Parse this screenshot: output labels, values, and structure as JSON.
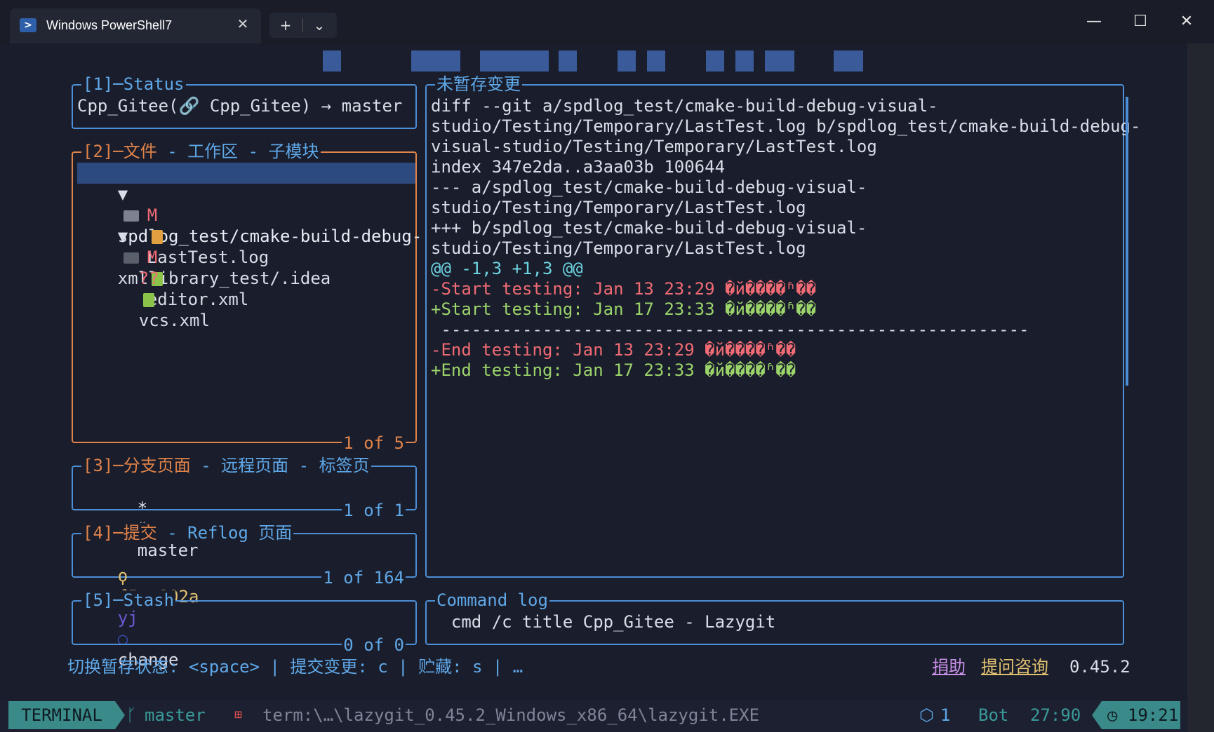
{
  "window": {
    "tab_title": "Windows PowerShell7",
    "tab_close": "✕",
    "new_tab": "+",
    "dropdown": "⌄",
    "minimize": "—",
    "maximize": "☐",
    "close": "✕",
    "tab_icon": ">"
  },
  "status_panel": {
    "title": "[1]─Status",
    "line": "Cpp_Gitee(🔗 Cpp_Gitee) → master"
  },
  "files_panel": {
    "title_active": "[2]─文件",
    "title_rest": " - 工作区 - 子模块",
    "footer": "1 of 5",
    "rows": [
      {
        "arrow": "▼",
        "status": "",
        "name": "spdlog_test/cmake-build-debug-"
      },
      {
        "arrow": "",
        "status": "M",
        "name": "LastTest.log"
      },
      {
        "arrow": "▼",
        "status": "",
        "name": "xmllibrary_test/.idea"
      },
      {
        "arrow": "",
        "status": "M",
        "name": "editor.xml"
      },
      {
        "arrow": "",
        "status": "??",
        "name": "vcs.xml"
      }
    ]
  },
  "branches_panel": {
    "title_active": "[3]─分支页面",
    "title_rest": " - 远程页面 - 标签页",
    "footer": "1 of 1",
    "line_star": "*",
    "line_branch": "master"
  },
  "commits_panel": {
    "title_active": "[4]─提交",
    "title_rest": " - Reflog 页面",
    "footer": "1 of 164",
    "hash": "f5aa802a",
    "author": "yj",
    "message": "change"
  },
  "stash_panel": {
    "title": "[5]─Stash",
    "footer": "0 of 0"
  },
  "diff_panel": {
    "title": "未暂存变更",
    "lines": [
      {
        "type": "normal",
        "text": "diff --git a/spdlog_test/cmake-build-debug-visual-"
      },
      {
        "type": "normal",
        "text": "studio/Testing/Temporary/LastTest.log b/spdlog_test/cmake-build-debug-"
      },
      {
        "type": "normal",
        "text": "visual-studio/Testing/Temporary/LastTest.log"
      },
      {
        "type": "normal",
        "text": "index 347e2da..a3aa03b 100644"
      },
      {
        "type": "normal",
        "text": "--- a/spdlog_test/cmake-build-debug-visual-"
      },
      {
        "type": "normal",
        "text": "studio/Testing/Temporary/LastTest.log"
      },
      {
        "type": "normal",
        "text": "+++ b/spdlog_test/cmake-build-debug-visual-"
      },
      {
        "type": "normal",
        "text": "studio/Testing/Temporary/LastTest.log"
      },
      {
        "type": "hunk",
        "text": "@@ -1,3 +1,3 @@"
      },
      {
        "type": "del",
        "text": "-Start testing: Jan 13 23:29 �й����ʱ��"
      },
      {
        "type": "add",
        "text": "+Start testing: Jan 17 23:33 �й����ʱ��"
      },
      {
        "type": "normal",
        "text": " ----------------------------------------------------------"
      },
      {
        "type": "del",
        "text": "-End testing: Jan 13 23:29 �й����ʱ��"
      },
      {
        "type": "add",
        "text": "+End testing: Jan 17 23:33 �й����ʱ��"
      }
    ]
  },
  "command_log": {
    "title": "Command log",
    "line": "  cmd /c title Cpp_Gitee - Lazygit"
  },
  "statusbar": {
    "keys": "切换暂存状态: <space> | 提交变更: c | 贮藏: s | …",
    "donate": "捐助",
    "ask": "提问咨询",
    "version": "0.45.2"
  },
  "bottom": {
    "mode": "TERMINAL",
    "branch": "master",
    "term": "term:\\…\\lazygit_0.45.2_Windows_x86_64\\lazygit.EXE",
    "count": "1",
    "pos_label": "Bot",
    "pos": "27:90",
    "clock": "19:21",
    "branch_icon": "ᚴ",
    "count_icon": "⬡",
    "clock_icon": "◷"
  },
  "colors": {
    "accent_blue": "#4d8fd6",
    "accent_orange": "#e0834a",
    "diff_red": "#f06b74",
    "diff_green": "#9bd46a",
    "diff_cyan": "#6cd3e0",
    "mode_teal": "#3a8a8a"
  }
}
